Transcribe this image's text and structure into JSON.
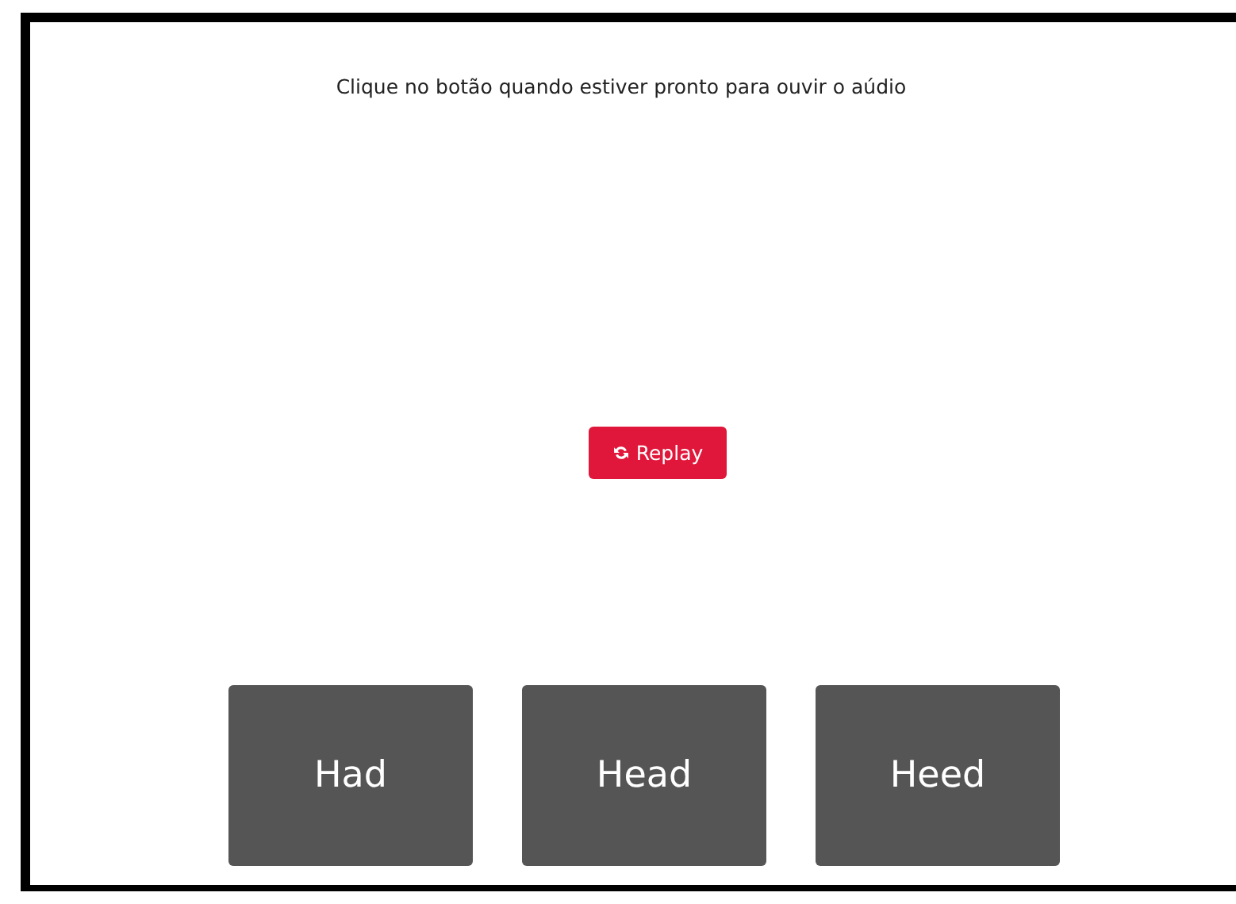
{
  "instruction": "Clique no botão quando estiver pronto para ouvir o aúdio",
  "replay_button": {
    "label": "Replay"
  },
  "options": [
    {
      "label": "Had"
    },
    {
      "label": "Head"
    },
    {
      "label": "Heed"
    }
  ]
}
